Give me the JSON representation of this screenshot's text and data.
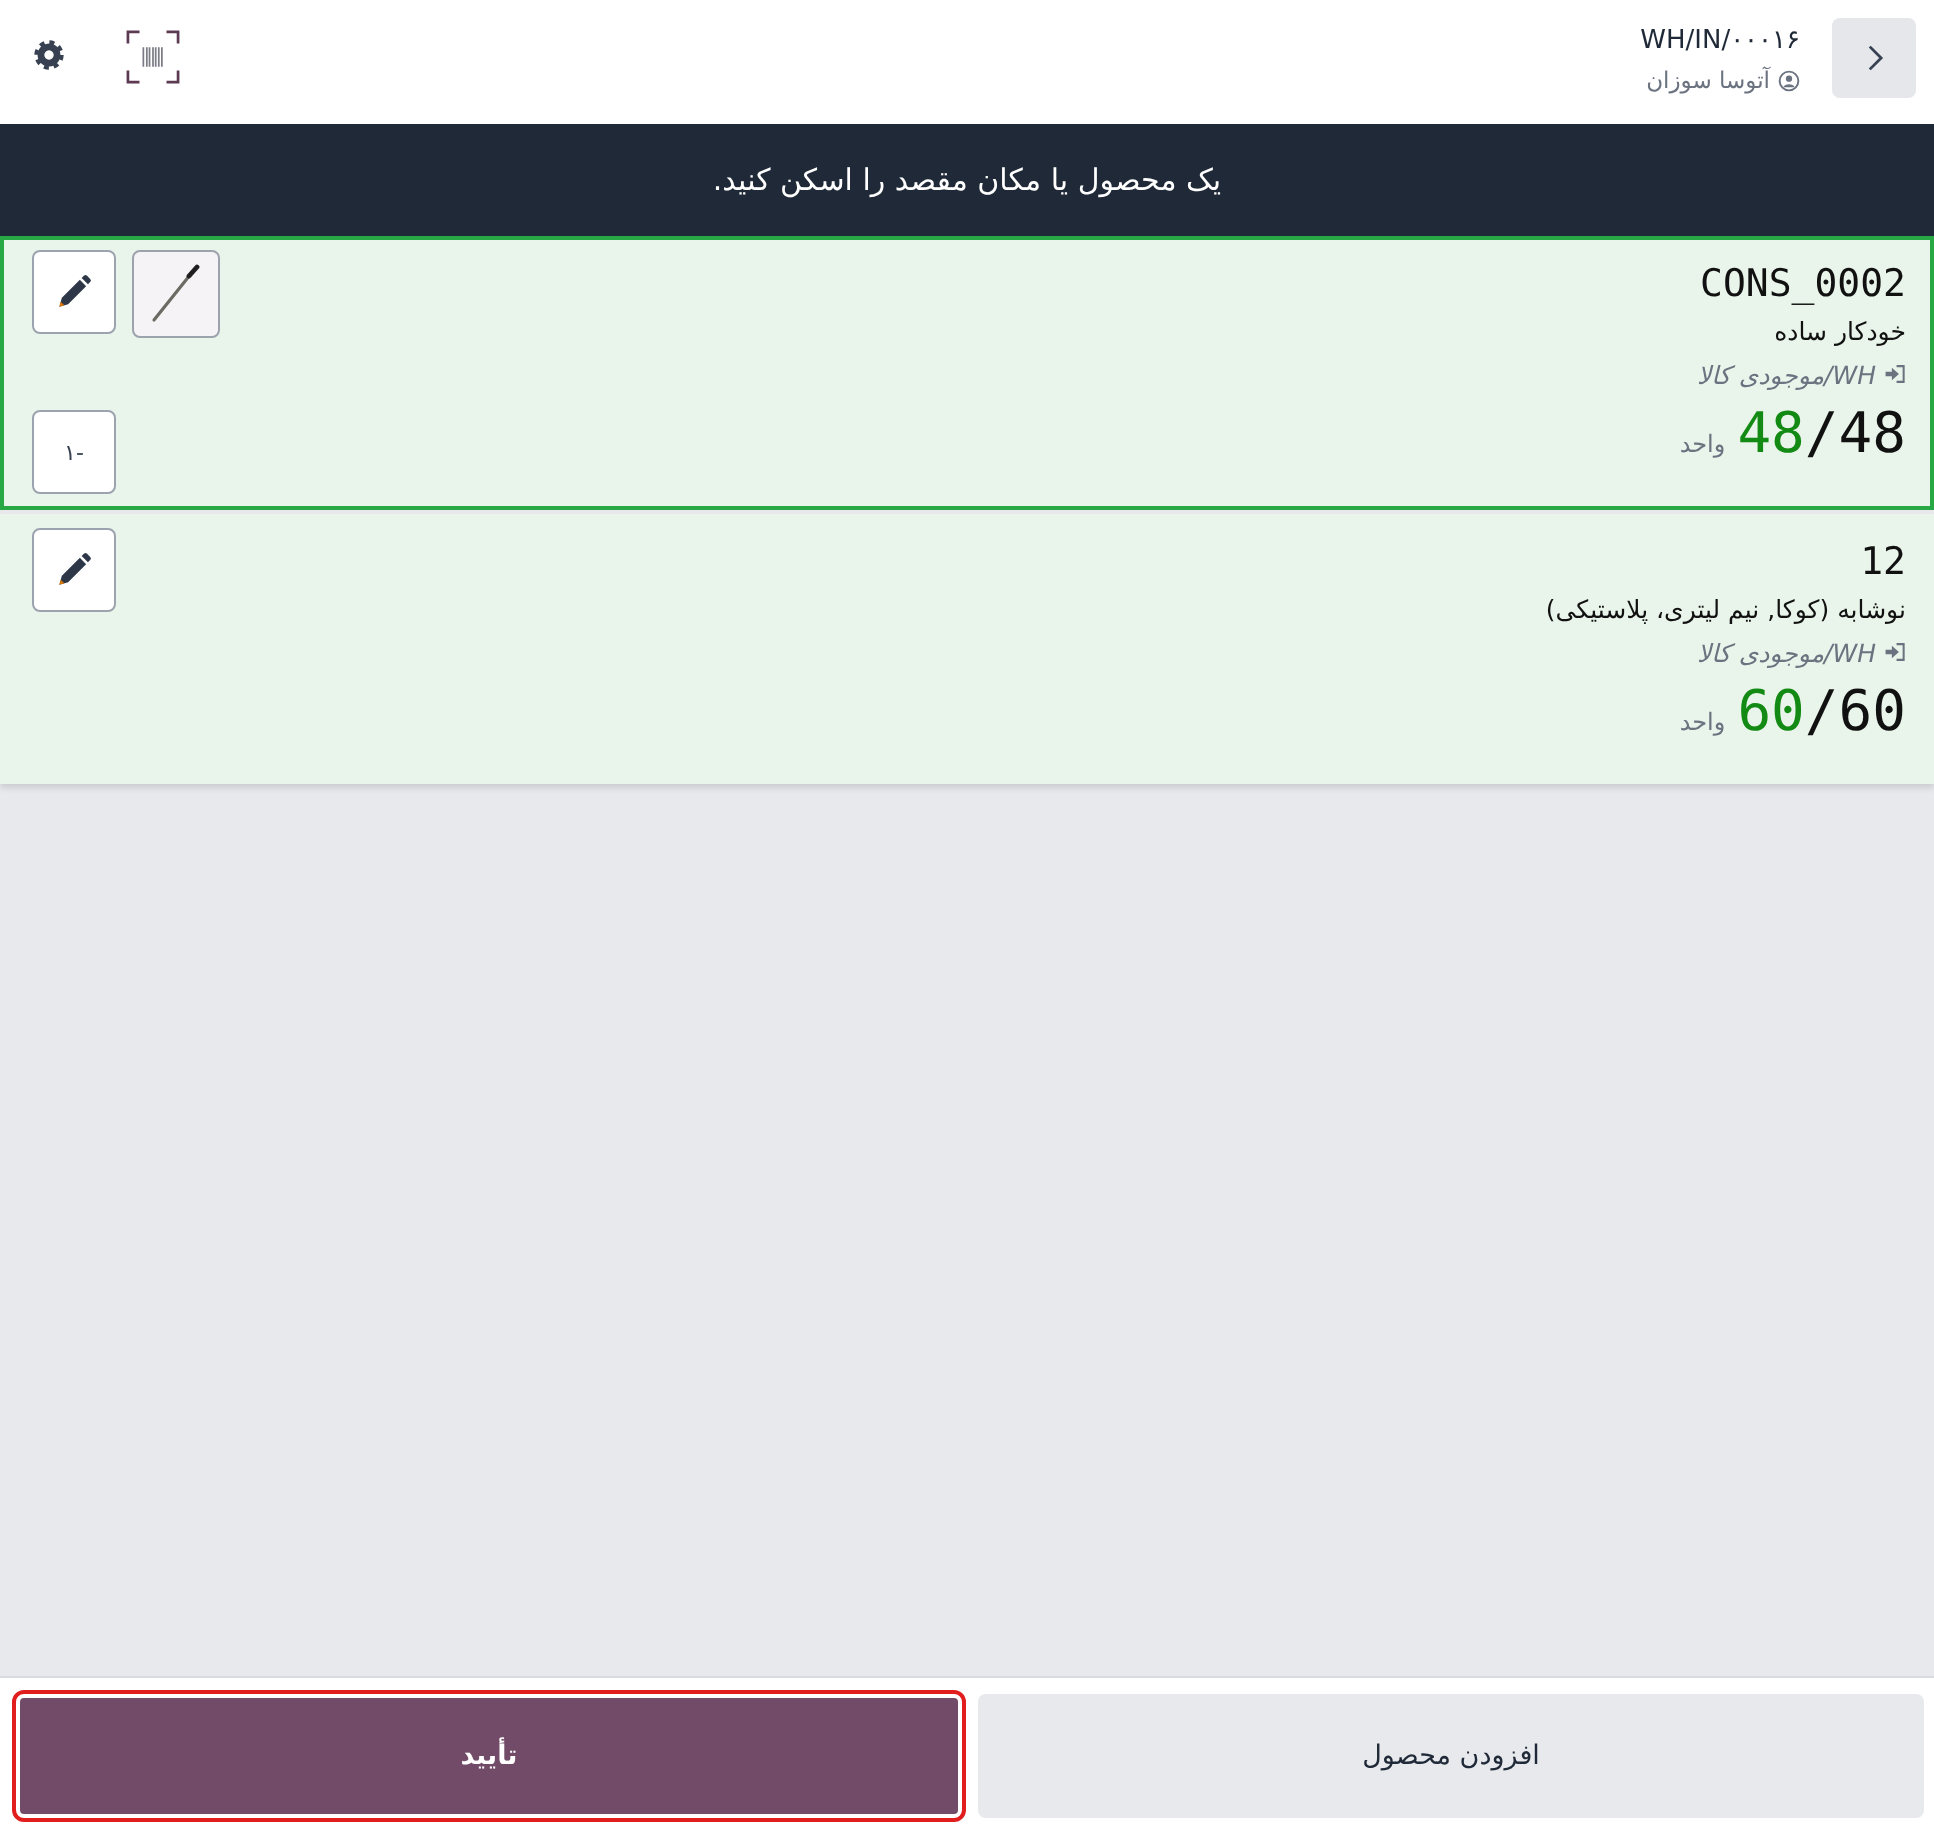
{
  "header": {
    "title": "WH/IN/۰۰۰۱۶",
    "user": "آتوسا سوزان"
  },
  "banner": {
    "text": "یک محصول یا مکان مقصد را اسکن کنید."
  },
  "lines": [
    {
      "selected": true,
      "code": "CONS_0002",
      "name": "خودکار ساده",
      "location": "WH/موجودی کالا",
      "qty_done": "48",
      "qty_demand": "/48",
      "unit": "واحد",
      "has_image": true,
      "decrement": "۱-"
    },
    {
      "selected": false,
      "code": "12",
      "name": "نوشابه (کوکا, نیم لیتری، پلاستیکی)",
      "location": "WH/موجودی کالا",
      "qty_done": "60",
      "qty_demand": "/60",
      "unit": "واحد",
      "has_image": false
    }
  ],
  "footer": {
    "buttons": [
      {
        "label": "افزودن محصول",
        "kind": "secondary",
        "focused": false
      },
      {
        "label": "تأیید",
        "kind": "primary",
        "focused": true
      }
    ]
  }
}
